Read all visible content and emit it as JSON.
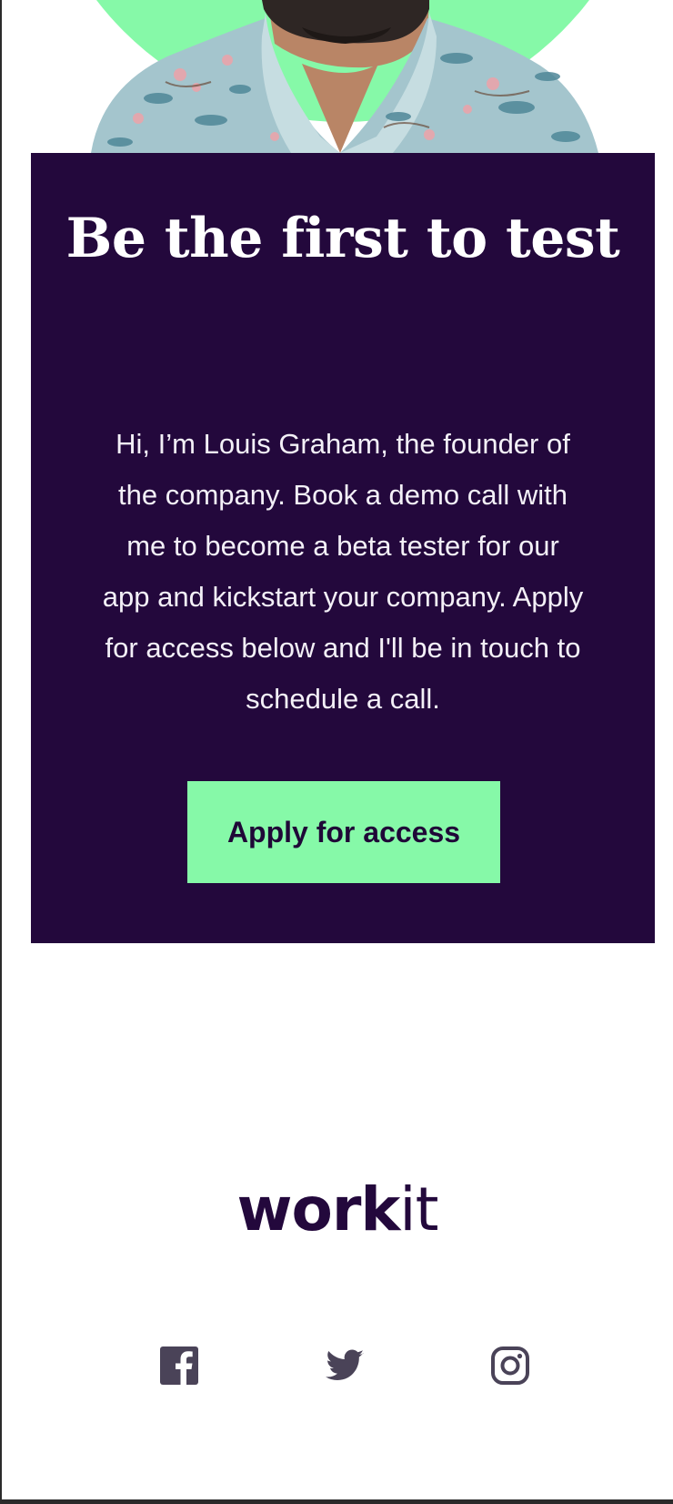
{
  "hero": {
    "photo_alt": "Louis Graham portrait",
    "accent_color": "#86f9a8"
  },
  "card": {
    "title": "Be the first to test",
    "body": "Hi, I’m Louis Graham, the founder of the company. Book a demo call with me to become a beta tester for our app and kickstart your company. Apply for access below and I'll be in touch to schedule a call.",
    "cta_label": "Apply for access",
    "background_color": "#23083c"
  },
  "footer": {
    "logo_bold": "work",
    "logo_light": "it",
    "social": [
      {
        "name": "facebook",
        "icon": "facebook-icon"
      },
      {
        "name": "twitter",
        "icon": "twitter-icon"
      },
      {
        "name": "instagram",
        "icon": "instagram-icon"
      }
    ],
    "icon_color": "#4a4358"
  }
}
